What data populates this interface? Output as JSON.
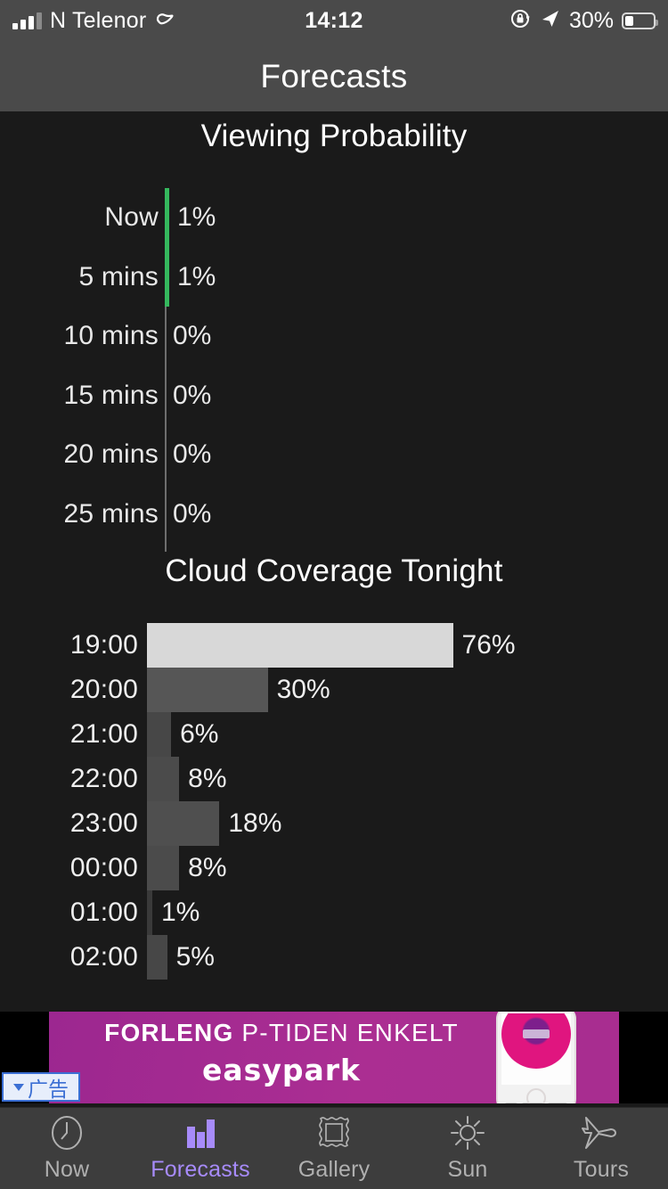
{
  "status_bar": {
    "carrier": "N Telenor",
    "time": "14:12",
    "battery_percent": "30%",
    "battery_level": 30,
    "icons": [
      "signal-bars-icon",
      "carrier-sync-icon",
      "rotation-lock-icon",
      "location-arrow-icon",
      "battery-icon"
    ]
  },
  "nav": {
    "title": "Forecasts"
  },
  "chart_data": [
    {
      "type": "bar",
      "orientation": "horizontal",
      "title": "Viewing Probability",
      "xlabel": "",
      "ylabel": "",
      "xlim": [
        0,
        100
      ],
      "grid": false,
      "bar_color": "#35b85d",
      "categories": [
        "Now",
        "5 mins",
        "10 mins",
        "15 mins",
        "20 mins",
        "25 mins"
      ],
      "values": [
        1,
        1,
        0,
        0,
        0,
        0
      ],
      "value_labels": [
        "1%",
        "1%",
        "0%",
        "0%",
        "0%",
        "0%"
      ]
    },
    {
      "type": "bar",
      "orientation": "horizontal",
      "title": "Cloud Coverage Tonight",
      "xlabel": "",
      "ylabel": "",
      "xlim": [
        0,
        100
      ],
      "grid": false,
      "categories": [
        "19:00",
        "20:00",
        "21:00",
        "22:00",
        "23:00",
        "00:00",
        "01:00",
        "02:00"
      ],
      "values": [
        76,
        30,
        6,
        8,
        18,
        8,
        1,
        5
      ],
      "value_labels": [
        "76%",
        "30%",
        "6%",
        "8%",
        "18%",
        "8%",
        "1%",
        "5%"
      ],
      "bar_colors": [
        "#d8d8d8",
        "#565656",
        "#474747",
        "#4b4b4b",
        "#4f4f4f",
        "#4b4b4b",
        "#3a3a3a",
        "#474747"
      ]
    }
  ],
  "ad": {
    "headline_bold": "FORLENG",
    "headline_rest": " P-TIDEN ENKELT",
    "brand": "easypark",
    "label_badge": "广告"
  },
  "tabbar": {
    "items": [
      {
        "label": "Now",
        "icon": "clock-icon",
        "active": false
      },
      {
        "label": "Forecasts",
        "icon": "bar-chart-icon",
        "active": true
      },
      {
        "label": "Gallery",
        "icon": "picture-frame-icon",
        "active": false
      },
      {
        "label": "Sun",
        "icon": "sun-icon",
        "active": false
      },
      {
        "label": "Tours",
        "icon": "airplane-icon",
        "active": false
      }
    ]
  },
  "colors": {
    "accent": "#a78bfa",
    "probability_bar": "#35b85d",
    "background": "#1a1a1a",
    "chrome": "#4a4a4a",
    "ad_magenta": "#a02a8f"
  }
}
